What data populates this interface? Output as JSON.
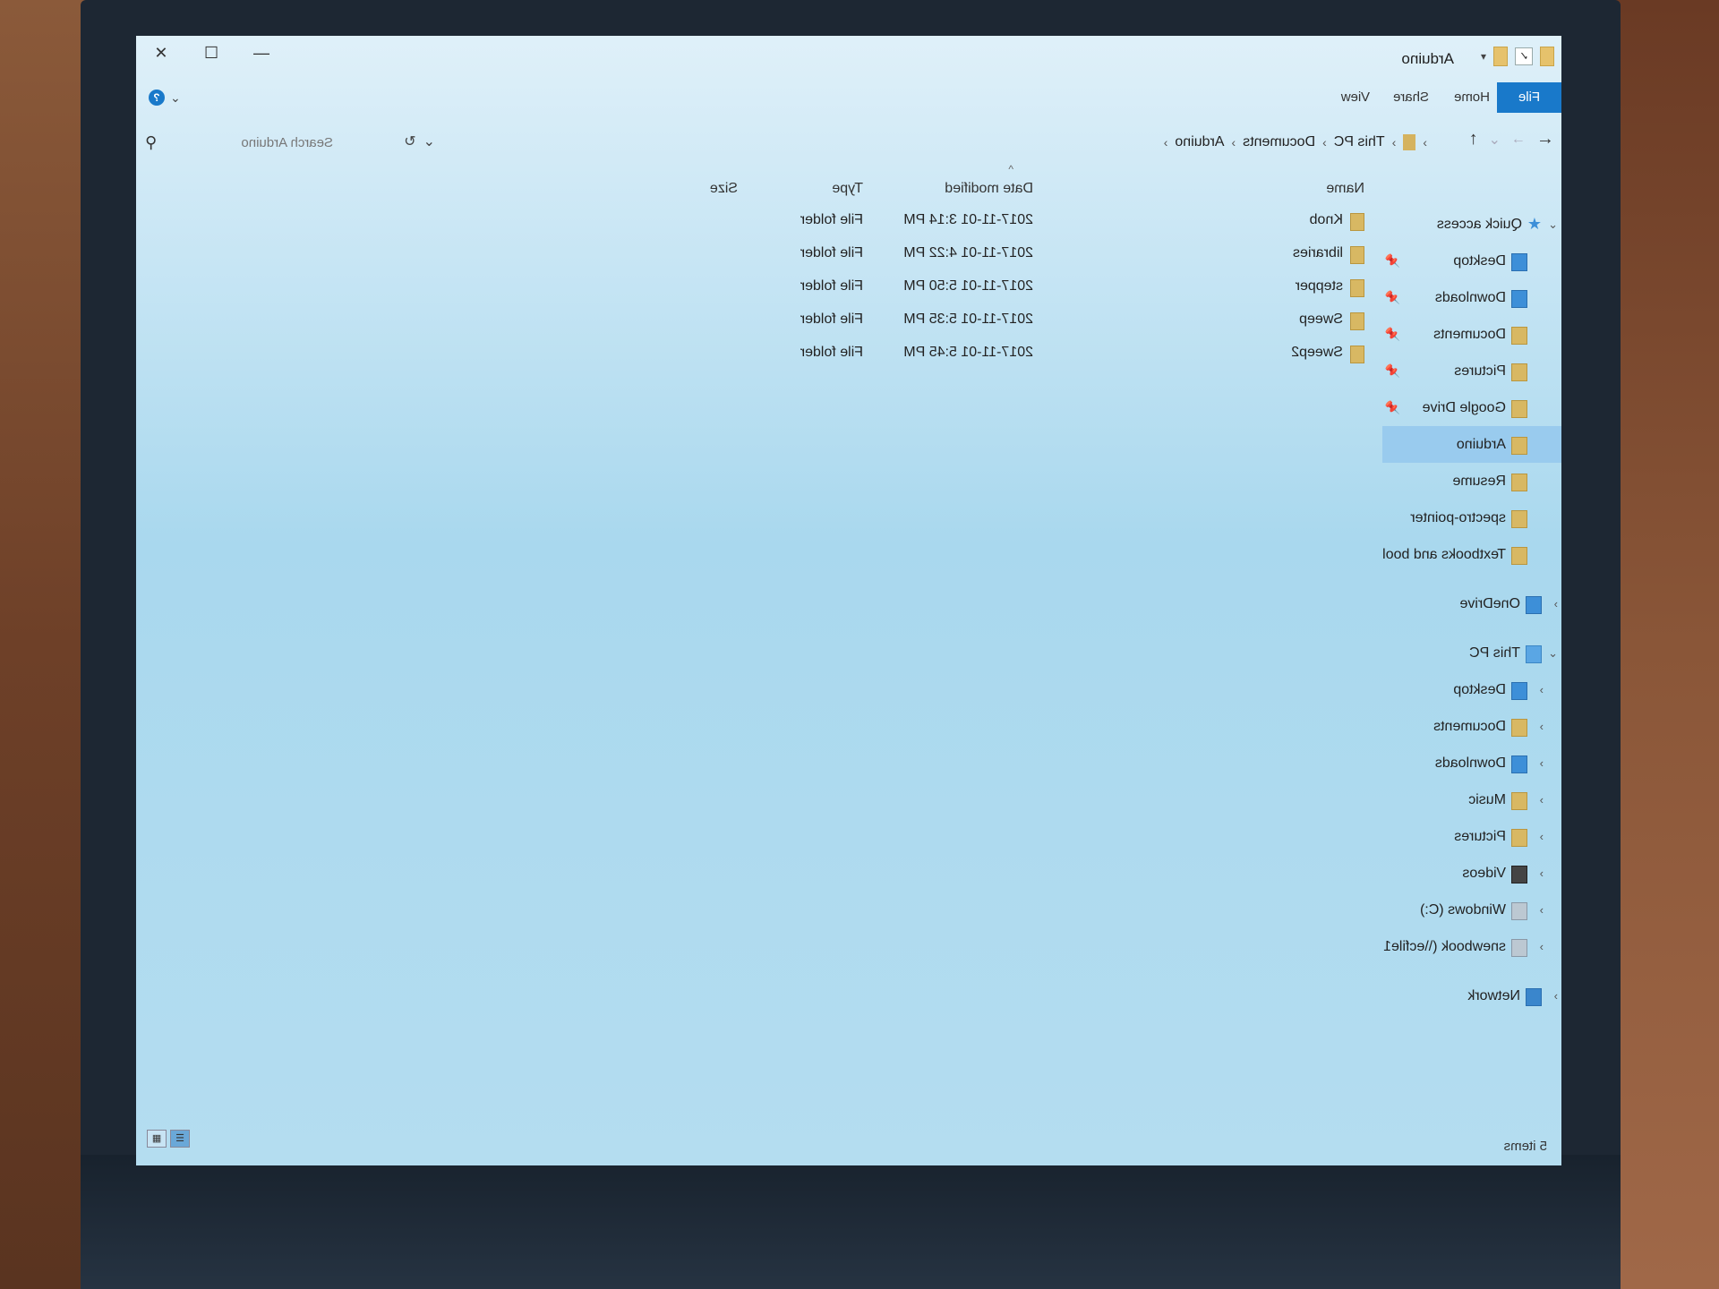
{
  "window": {
    "title": "Arduino",
    "controls": {
      "minimize": "—",
      "maximize": "☐",
      "close": "✕"
    }
  },
  "ribbon": {
    "tabs": [
      "File",
      "Home",
      "Share",
      "View"
    ],
    "help": "?"
  },
  "address": {
    "crumbs": [
      "This PC",
      "Documents",
      "Arduino"
    ],
    "search_placeholder": "Search Arduino"
  },
  "sidebar": {
    "quick_access": {
      "label": "Quick access",
      "items": [
        {
          "label": "Desktop",
          "pinned": true
        },
        {
          "label": "Downloads",
          "pinned": true
        },
        {
          "label": "Documents",
          "pinned": true
        },
        {
          "label": "Pictures",
          "pinned": true
        },
        {
          "label": "Google Drive",
          "pinned": true
        },
        {
          "label": "Arduino",
          "pinned": false,
          "selected": true
        },
        {
          "label": "Resume",
          "pinned": false
        },
        {
          "label": "spectro-pointer",
          "pinned": false
        },
        {
          "label": "Textbooks and bool",
          "pinned": false
        }
      ]
    },
    "onedrive": "OneDrive",
    "this_pc": {
      "label": "This PC",
      "items": [
        "Desktop",
        "Documents",
        "Downloads",
        "Music",
        "Pictures",
        "Videos",
        "Windows (C:)",
        "snewbook (\\\\ecfile1"
      ]
    },
    "network": "Network"
  },
  "filelist": {
    "columns": {
      "name": "Name",
      "date": "Date modified",
      "type": "Type",
      "size": "Size"
    },
    "rows": [
      {
        "name": "Knob",
        "date": "2017-11-01 3:14 PM",
        "type": "File folder",
        "size": ""
      },
      {
        "name": "libraries",
        "date": "2017-11-01 4:22 PM",
        "type": "File folder",
        "size": ""
      },
      {
        "name": "stepper",
        "date": "2017-11-01 5:50 PM",
        "type": "File folder",
        "size": ""
      },
      {
        "name": "Sweep",
        "date": "2017-11-01 5:35 PM",
        "type": "File folder",
        "size": ""
      },
      {
        "name": "Sweep2",
        "date": "2017-11-01 5:45 PM",
        "type": "File folder",
        "size": ""
      }
    ]
  },
  "status": {
    "items": "5 items"
  }
}
